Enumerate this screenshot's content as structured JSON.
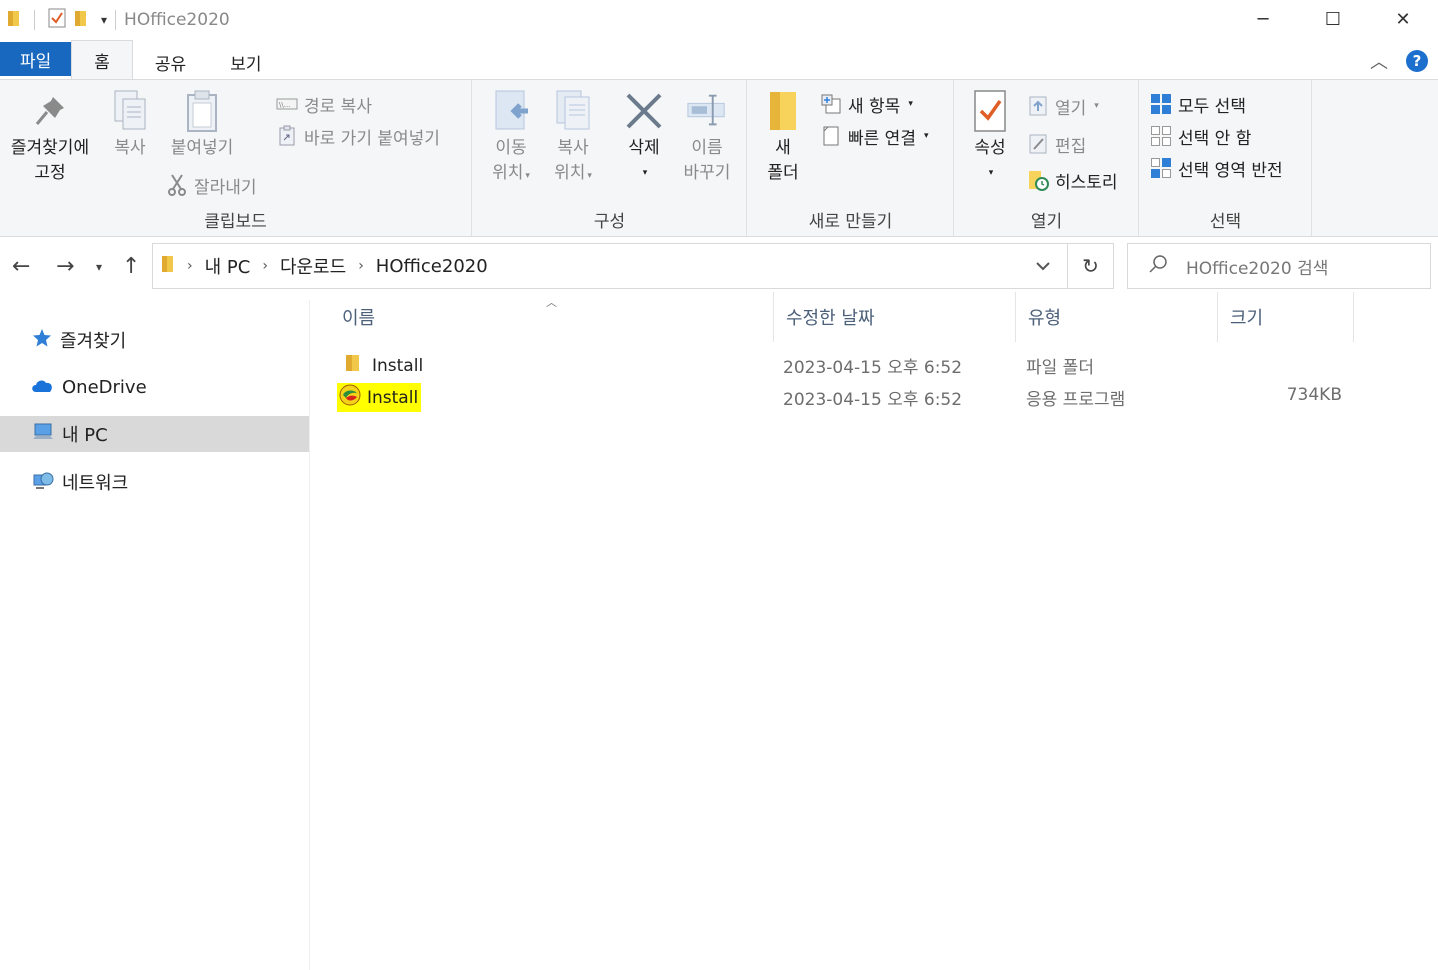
{
  "window": {
    "title": "HOffice2020",
    "minimize": "─",
    "maximize": "☐",
    "close": "✕"
  },
  "tabs": [
    "파일",
    "홈",
    "공유",
    "보기"
  ],
  "ribbon": {
    "clipboard": {
      "label": "클립보드",
      "pin": [
        "즐겨찾기에",
        "고정"
      ],
      "copy": "복사",
      "paste": "붙여넣기",
      "copy_path": "경로 복사",
      "paste_shortcut": "바로 가기 붙여넣기",
      "cut": "잘라내기"
    },
    "organize": {
      "label": "구성",
      "move": [
        "이동",
        "위치"
      ],
      "copy_to": [
        "복사",
        "위치"
      ],
      "delete": "삭제",
      "rename": [
        "이름",
        "바꾸기"
      ]
    },
    "new": {
      "label": "새로 만들기",
      "new_folder": [
        "새",
        "폴더"
      ],
      "new_item": "새 항목",
      "easy_access": "빠른 연결"
    },
    "open": {
      "label": "열기",
      "properties": "속성",
      "open": "열기",
      "edit": "편집",
      "history": "히스토리"
    },
    "select": {
      "label": "선택",
      "select_all": "모두 선택",
      "select_none": "선택 안 함",
      "invert": "선택 영역 반전"
    }
  },
  "address": {
    "crumbs": [
      "내 PC",
      "다운로드",
      "HOffice2020"
    ],
    "search_placeholder": "HOffice2020 검색"
  },
  "nav": {
    "items": [
      "즐겨찾기",
      "OneDrive",
      "내 PC",
      "네트워크"
    ],
    "selected": "내 PC"
  },
  "columns": [
    "이름",
    "수정한 날짜",
    "유형",
    "크기"
  ],
  "files": [
    {
      "name": "Install",
      "date": "2023-04-15 오후 6:52",
      "type": "파일 폴더",
      "size": "",
      "icon": "folder-icon"
    },
    {
      "name": "Install",
      "date": "2023-04-15 오후 6:52",
      "type": "응용 프로그램",
      "size": "734KB",
      "icon": "hancom-installer-icon",
      "highlighted": true
    }
  ],
  "colors": {
    "file_tab": "#1968c0",
    "highlight": "#ffff00",
    "folder": "#f2c84b",
    "accent_blue": "#2f7fd6"
  }
}
